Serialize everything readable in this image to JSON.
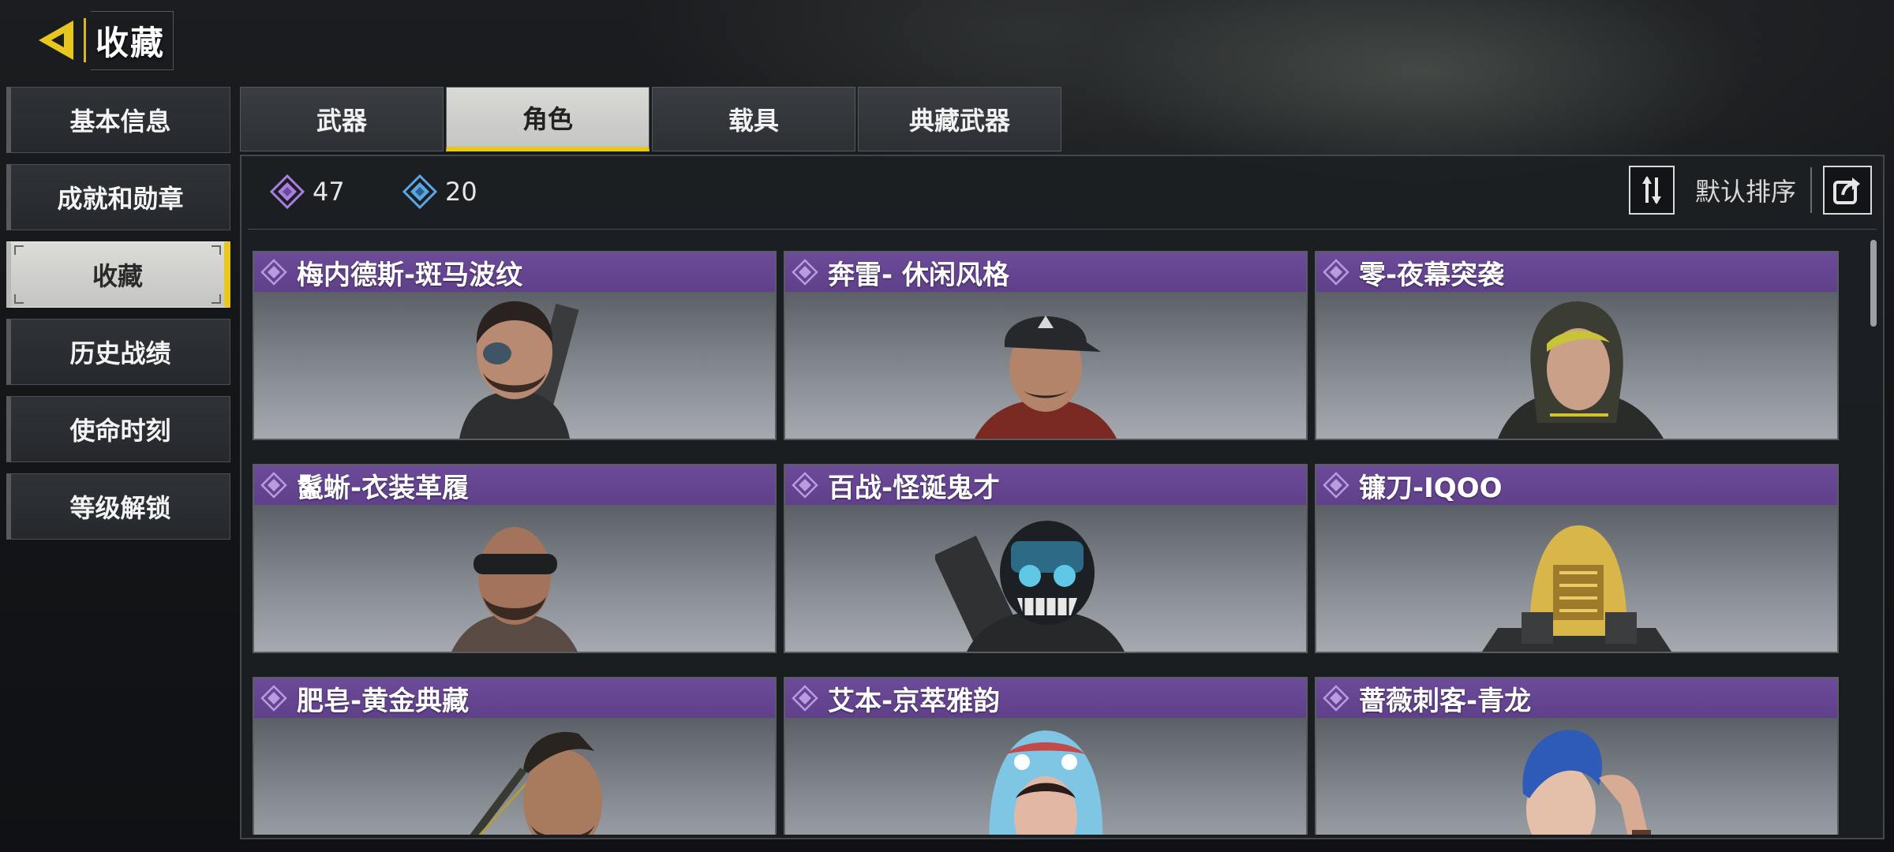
{
  "header": {
    "title": "收藏",
    "back_icon": "back-arrow-icon"
  },
  "colors": {
    "accent": "#e8c61e",
    "card_header": "#6c4b99",
    "currency_purple": "#a87ee0",
    "currency_blue": "#5ba7e6"
  },
  "sidebar": {
    "items": [
      {
        "label": "基本信息",
        "active": false
      },
      {
        "label": "成就和勋章",
        "active": false
      },
      {
        "label": "收藏",
        "active": true
      },
      {
        "label": "历史战绩",
        "active": false
      },
      {
        "label": "使命时刻",
        "active": false
      },
      {
        "label": "等级解锁",
        "active": false
      }
    ]
  },
  "tabs": [
    {
      "label": "武器",
      "active": false
    },
    {
      "label": "角色",
      "active": true
    },
    {
      "label": "载具",
      "active": false
    },
    {
      "label": "典藏武器",
      "active": false
    }
  ],
  "toolbar": {
    "currency_purple_count": "47",
    "currency_blue_count": "20",
    "sort_label": "默认排序",
    "sort_icon": "sort-icon",
    "share_icon": "share-icon"
  },
  "cards": [
    {
      "name": "梅内德斯-斑马波纹",
      "icon": "rarity-diamond-icon"
    },
    {
      "name": "奔雷- 休闲风格",
      "icon": "rarity-diamond-icon"
    },
    {
      "name": "零-夜幕突袭",
      "icon": "rarity-diamond-icon"
    },
    {
      "name": "鬣蜥-衣装革履",
      "icon": "rarity-diamond-icon"
    },
    {
      "name": "百战-怪诞鬼才",
      "icon": "rarity-diamond-icon"
    },
    {
      "name": "镰刀-IQOO",
      "icon": "rarity-diamond-icon"
    },
    {
      "name": "肥皂-黄金典藏",
      "icon": "rarity-diamond-icon"
    },
    {
      "name": "艾本-京萃雅韵",
      "icon": "rarity-diamond-icon"
    },
    {
      "name": "蔷薇刺客-青龙",
      "icon": "rarity-diamond-icon"
    }
  ]
}
